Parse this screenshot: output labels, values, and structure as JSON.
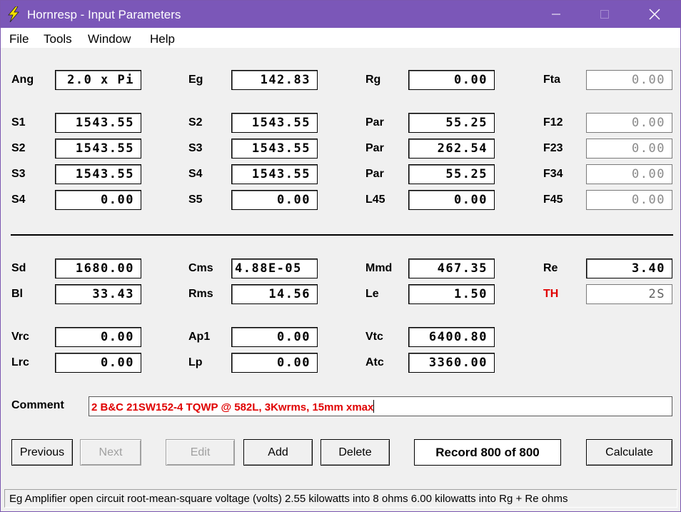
{
  "window": {
    "title": "Hornresp - Input Parameters",
    "accent_color": "#7b57b8"
  },
  "menu": {
    "file": "File",
    "tools": "Tools",
    "window": "Window",
    "help": "Help"
  },
  "params": {
    "row1": [
      {
        "label": "Ang",
        "value": "2.0 x Pi"
      },
      {
        "label": "Eg",
        "value": "142.83"
      },
      {
        "label": "Rg",
        "value": "0.00"
      },
      {
        "label": "Fta",
        "value": "0.00"
      }
    ],
    "row2": [
      {
        "label": "S1",
        "value": "1543.55"
      },
      {
        "label": "S2",
        "value": "1543.55"
      },
      {
        "label": "Par",
        "value": "55.25"
      },
      {
        "label": "F12",
        "value": "0.00"
      }
    ],
    "row3": [
      {
        "label": "S2",
        "value": "1543.55"
      },
      {
        "label": "S3",
        "value": "1543.55"
      },
      {
        "label": "Par",
        "value": "262.54"
      },
      {
        "label": "F23",
        "value": "0.00"
      }
    ],
    "row4": [
      {
        "label": "S3",
        "value": "1543.55"
      },
      {
        "label": "S4",
        "value": "1543.55"
      },
      {
        "label": "Par",
        "value": "55.25"
      },
      {
        "label": "F34",
        "value": "0.00"
      }
    ],
    "row5": [
      {
        "label": "S4",
        "value": "0.00"
      },
      {
        "label": "S5",
        "value": "0.00"
      },
      {
        "label": "L45",
        "value": "0.00"
      },
      {
        "label": "F45",
        "value": "0.00"
      }
    ],
    "row6": [
      {
        "label": "Sd",
        "value": "1680.00"
      },
      {
        "label": "Cms",
        "value": "4.88E-05"
      },
      {
        "label": "Mmd",
        "value": "467.35"
      },
      {
        "label": "Re",
        "value": "3.40"
      }
    ],
    "row7": [
      {
        "label": "Bl",
        "value": "33.43"
      },
      {
        "label": "Rms",
        "value": "14.56"
      },
      {
        "label": "Le",
        "value": "1.50"
      },
      {
        "label": "TH",
        "value": "2S"
      }
    ],
    "row8": [
      {
        "label": "Vrc",
        "value": "0.00"
      },
      {
        "label": "Ap1",
        "value": "0.00"
      },
      {
        "label": "Vtc",
        "value": "6400.80"
      }
    ],
    "row9": [
      {
        "label": "Lrc",
        "value": "0.00"
      },
      {
        "label": "Lp",
        "value": "0.00"
      },
      {
        "label": "Atc",
        "value": "3360.00"
      }
    ]
  },
  "comment": {
    "label": "Comment",
    "value": "2 B&C 21SW152-4 TQWP @ 582L, 3Kwrms, 15mm xmax"
  },
  "buttons": {
    "previous": "Previous",
    "next": "Next",
    "edit": "Edit",
    "add": "Add",
    "delete": "Delete",
    "record": "Record 800 of 800",
    "calculate": "Calculate"
  },
  "status": "Eg  Amplifier open circuit root-mean-square voltage  (volts)   2.55 kilowatts into 8 ohms   6.00 kilowatts into Rg + Re ohms"
}
